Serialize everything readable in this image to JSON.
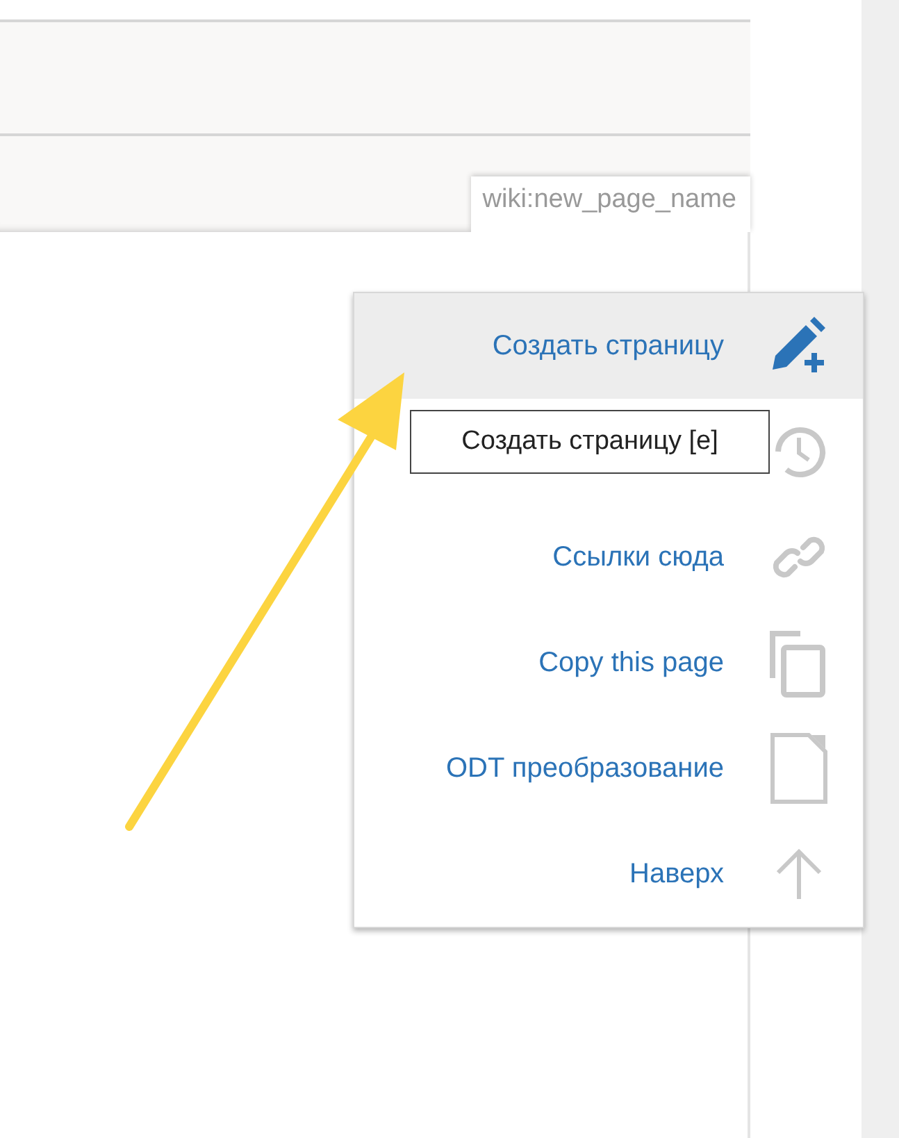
{
  "page_tab": {
    "label": "wiki:new_page_name"
  },
  "page_tools": [
    {
      "kind": "create",
      "label": "Создать страницу",
      "selected": true
    },
    {
      "kind": "history",
      "selected": false
    },
    {
      "kind": "backlinks",
      "label": "Ссылки сюда",
      "selected": false
    },
    {
      "kind": "copy",
      "label": "Copy this page",
      "selected": false
    },
    {
      "kind": "odt",
      "label": "ODT преобразование",
      "selected": false
    },
    {
      "kind": "top",
      "label": "Наверх",
      "selected": false
    }
  ],
  "tooltip": {
    "text": "Создать страницу [e]"
  }
}
